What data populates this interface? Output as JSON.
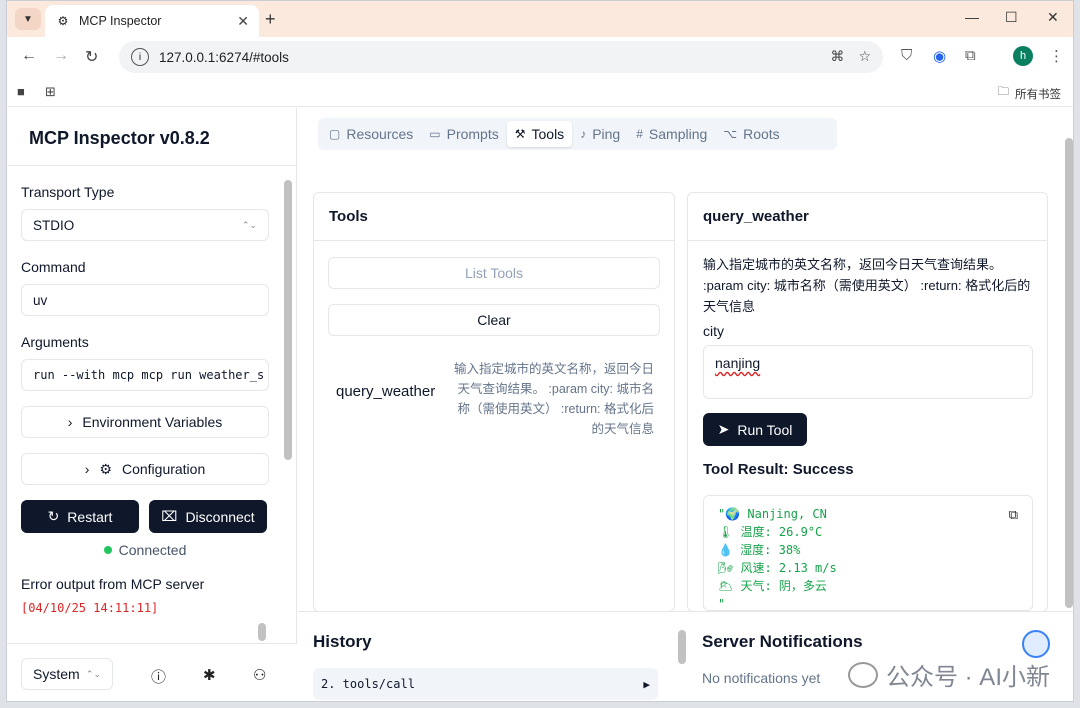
{
  "browser": {
    "tab_title": "MCP Inspector",
    "url": "127.0.0.1:6274/#tools",
    "bookmarks_all": "所有书签",
    "profile_initial": "h"
  },
  "sidebar": {
    "title": "MCP Inspector v0.8.2",
    "transport_label": "Transport Type",
    "transport_value": "STDIO",
    "command_label": "Command",
    "command_value": "uv",
    "arguments_label": "Arguments",
    "arguments_value": "run --with mcp mcp run weather_s",
    "env_button": "Environment Variables",
    "config_button": "Configuration",
    "restart_button": "Restart",
    "disconnect_button": "Disconnect",
    "status": "Connected",
    "error_label": "Error output from MCP server",
    "error_line": "[04/10/25 14:11:11]",
    "theme_value": "System"
  },
  "tabs": [
    {
      "label": "Resources",
      "icon": "file-icon"
    },
    {
      "label": "Prompts",
      "icon": "message-icon"
    },
    {
      "label": "Tools",
      "icon": "hammer-icon"
    },
    {
      "label": "Ping",
      "icon": "bell-icon"
    },
    {
      "label": "Sampling",
      "icon": "hash-icon"
    },
    {
      "label": "Roots",
      "icon": "tree-icon"
    }
  ],
  "tools_panel": {
    "title": "Tools",
    "list_button": "List Tools",
    "clear_button": "Clear",
    "tool_name": "query_weather",
    "tool_desc": "输入指定城市的英文名称，返回今日天气查询结果。 :param city: 城市名称（需使用英文） :return: 格式化后的天气信息"
  },
  "tool_detail": {
    "title": "query_weather",
    "desc": "输入指定城市的英文名称，返回今日天气查询结果。 :param city: 城市名称（需使用英文） :return: 格式化后的天气信息",
    "param_label": "city",
    "param_value": "nanjing",
    "run_button": "Run Tool",
    "result_title": "Tool Result: Success",
    "result_lines": [
      "\"🌍 Nanjing, CN",
      "🌡 温度: 26.9°C",
      "💧 湿度: 38%",
      "🌬 风速: 2.13 m/s",
      "🌥 天气: 阴，多云",
      "\""
    ]
  },
  "history": {
    "title": "History",
    "item": "2. tools/call"
  },
  "notifications": {
    "title": "Server Notifications",
    "empty": "No notifications yet"
  },
  "watermark": "公众号 · AI小新"
}
